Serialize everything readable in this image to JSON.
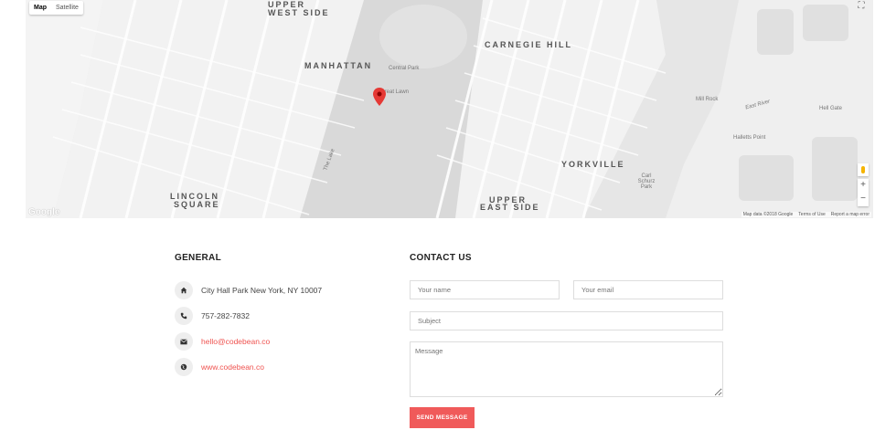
{
  "map": {
    "type_control": {
      "map_label": "Map",
      "satellite_label": "Satellite"
    },
    "fullscreen_glyph": "⛶",
    "zoom_in": "+",
    "zoom_out": "−",
    "logo": "Google",
    "attribution": {
      "data": "Map data ©2018 Google",
      "terms": "Terms of Use",
      "report": "Report a map error"
    },
    "labels": {
      "upper_west_side_1": "UPPER",
      "upper_west_side_2": "WEST SIDE",
      "manhattan": "MANHATTAN",
      "carnegie_hill": "CARNEGIE HILL",
      "yorkville": "YORKVILLE",
      "lincoln_square_1": "LINCOLN",
      "lincoln_square_2": "SQUARE",
      "upper_east_side_1": "UPPER",
      "upper_east_side_2": "EAST SIDE",
      "central_park": "Central Park",
      "great_lawn": "Great Lawn",
      "the_lake": "The Lake",
      "mill_rock": "Mill Rock",
      "hell_gate": "Hell Gate",
      "hallets_point": "Halletts Point",
      "east_river": "East River",
      "carl_schurz": "Carl Schurz Park"
    },
    "marker_color": "#e53935"
  },
  "general": {
    "title": "GENERAL",
    "address": "City Hall Park New York, NY 10007",
    "phone": "757-282-7832",
    "email": "hello@codebean.co",
    "website": "www.codebean.co"
  },
  "contact": {
    "title": "CONTACT US",
    "name_placeholder": "Your name",
    "email_placeholder": "Your email",
    "subject_placeholder": "Subject",
    "message_placeholder": "Message",
    "send_label": "SEND MESSAGE"
  },
  "colors": {
    "accent": "#f05a5a",
    "link": "#ef5350"
  }
}
